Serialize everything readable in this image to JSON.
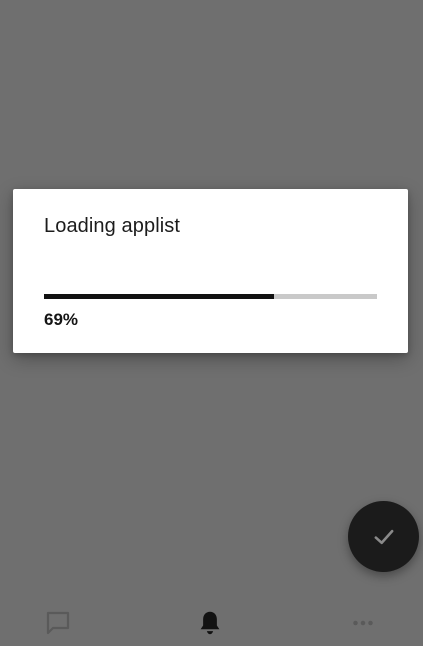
{
  "dialog": {
    "title": "Loading applist",
    "progress_fraction": 0.69,
    "progress_text": "69%"
  },
  "fab": {
    "icon": "check-icon"
  },
  "bottom_nav": {
    "items": [
      {
        "icon": "chat-bubble-icon"
      },
      {
        "icon": "bell-icon",
        "active": true
      },
      {
        "icon": "more-horizontal-icon"
      }
    ]
  },
  "colors": {
    "scrim": "#6f6f6f",
    "dialog_background": "#ffffff",
    "progress_fill": "#111111",
    "progress_track": "#c9c9c9",
    "fab_background": "#1b1b1b"
  }
}
